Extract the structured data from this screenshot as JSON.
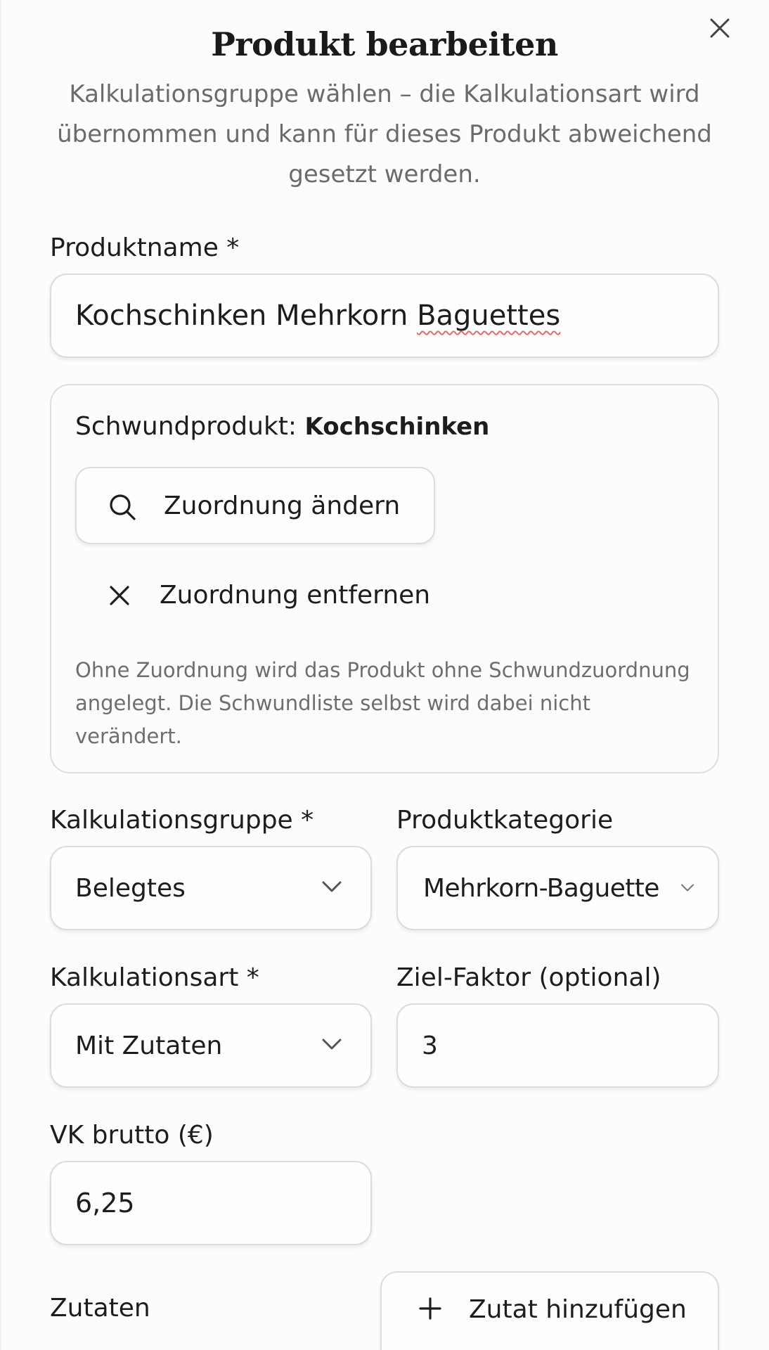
{
  "dialog": {
    "title": "Produkt bearbeiten",
    "subtitle": "Kalkulationsgruppe wählen – die Kalkulationsart wird übernommen und kann für dieses Produkt abweichend gesetzt werden.",
    "close_icon": "close-icon"
  },
  "product_name": {
    "label": "Produktname *",
    "value_part1": "Kochschinken Mehrkorn ",
    "value_part2": "Baguettes"
  },
  "shrink": {
    "label": "Schwundprodukt: ",
    "value": "Kochschinken",
    "change_label": "Zuordnung ändern",
    "change_icon": "search-icon",
    "remove_label": "Zuordnung entfernen",
    "remove_icon": "close-icon",
    "hint": "Ohne Zuordnung wird das Produkt ohne Schwundzuordnung angelegt. Die Schwundliste selbst wird dabei nicht verändert."
  },
  "calc_group": {
    "label": "Kalkulationsgruppe *",
    "value": "Belegtes"
  },
  "category": {
    "label": "Produktkategorie",
    "value": "Mehrkorn-Baguette"
  },
  "calc_type": {
    "label": "Kalkulationsart *",
    "value": "Mit Zutaten"
  },
  "target_factor": {
    "label": "Ziel-Faktor (optional)",
    "value": "3"
  },
  "price": {
    "label": "VK brutto (€)",
    "value": "6,25"
  },
  "ingredients": {
    "label": "Zutaten",
    "add_label": "Zutat hinzufügen",
    "add_icon": "plus-icon"
  }
}
